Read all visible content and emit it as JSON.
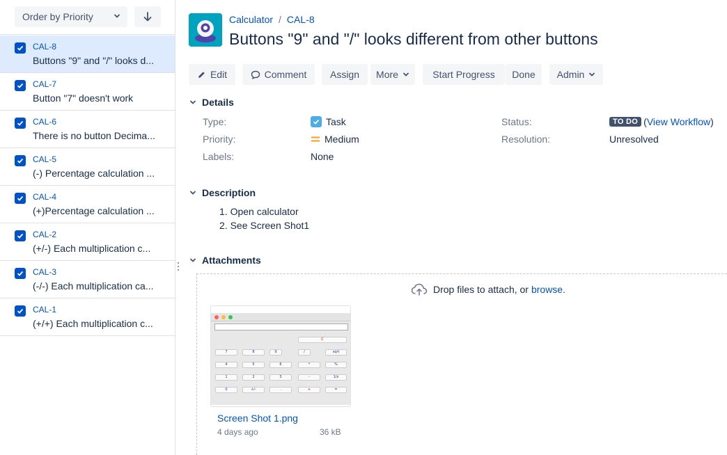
{
  "sidebar": {
    "order_label": "Order by Priority",
    "items": [
      {
        "key": "CAL-8",
        "summary": "Buttons \"9\" and \"/\" looks d...",
        "active": true
      },
      {
        "key": "CAL-7",
        "summary": "Button \"7\" doesn't work"
      },
      {
        "key": "CAL-6",
        "summary": "There is no button Decima..."
      },
      {
        "key": "CAL-5",
        "summary": "(-) Percentage calculation ..."
      },
      {
        "key": "CAL-4",
        "summary": "(+)Percentage calculation ..."
      },
      {
        "key": "CAL-2",
        "summary": "(+/-) Each multiplication c..."
      },
      {
        "key": "CAL-3",
        "summary": "(-/-) Each multiplication ca..."
      },
      {
        "key": "CAL-1",
        "summary": "(+/+) Each multiplication c..."
      }
    ]
  },
  "header": {
    "project": "Calculator",
    "issue_key": "CAL-8",
    "title": "Buttons \"9\" and \"/\" looks different from other buttons"
  },
  "toolbar": {
    "edit": "Edit",
    "comment": "Comment",
    "assign": "Assign",
    "more": "More",
    "start_progress": "Start Progress",
    "done": "Done",
    "admin": "Admin"
  },
  "details": {
    "heading": "Details",
    "type_label": "Type:",
    "type_value": "Task",
    "priority_label": "Priority:",
    "priority_value": "Medium",
    "labels_label": "Labels:",
    "labels_value": "None",
    "status_label": "Status:",
    "status_value": "TO DO",
    "view_workflow": "View Workflow",
    "resolution_label": "Resolution:",
    "resolution_value": "Unresolved"
  },
  "description": {
    "heading": "Description",
    "steps": [
      "1. Open calculator",
      "2. See Screen Shot1"
    ]
  },
  "attachments": {
    "heading": "Attachments",
    "drop_text": "Drop files to attach, or",
    "browse": "browse.",
    "file_name": "Screen Shot 1.png",
    "file_age": "4 days ago",
    "file_size": "36 kB"
  },
  "colors": {
    "accent": "#0052cc",
    "selected_bg": "#deebff",
    "button_bg": "#f4f5f7",
    "lozenge_bg": "#42526e",
    "priority_medium": "#ff991f"
  },
  "thumbnail_keys": [
    [
      "C"
    ],
    [
      "7",
      "8",
      "9",
      "/",
      "sqrt"
    ],
    [
      "4",
      "5",
      "6",
      "*",
      "%"
    ],
    [
      "1",
      "2",
      "3",
      "-",
      "1/x"
    ],
    [
      "0",
      "+/-",
      ".",
      "+",
      "="
    ]
  ]
}
